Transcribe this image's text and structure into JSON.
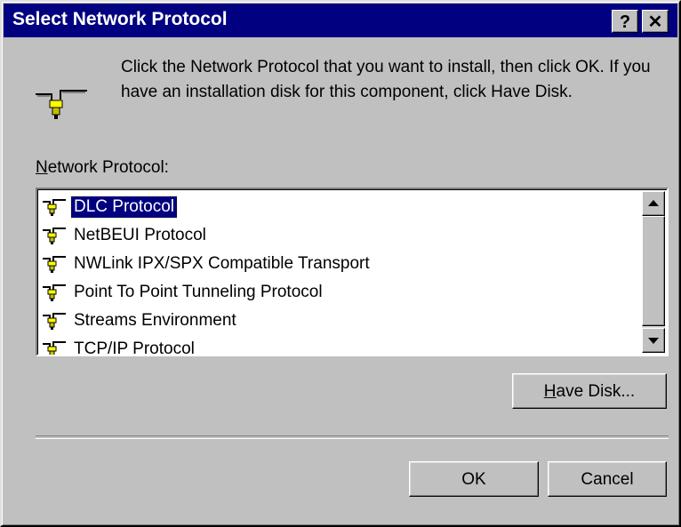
{
  "window": {
    "title": "Select Network Protocol",
    "help_label": "?",
    "close_label": "✕"
  },
  "instructions": "Click the Network Protocol that you want to install, then click OK.  If you have an installation disk for this component, click Have Disk.",
  "list": {
    "label_mnemonic": "N",
    "label_rest": "etwork Protocol:",
    "items": [
      {
        "label": "DLC Protocol",
        "selected": true
      },
      {
        "label": "NetBEUI Protocol",
        "selected": false
      },
      {
        "label": "NWLink IPX/SPX Compatible Transport",
        "selected": false
      },
      {
        "label": "Point To Point Tunneling Protocol",
        "selected": false
      },
      {
        "label": "Streams Environment",
        "selected": false
      },
      {
        "label": "TCP/IP Protocol",
        "selected": false
      }
    ]
  },
  "buttons": {
    "have_disk_mnemonic": "H",
    "have_disk_rest": "ave Disk...",
    "ok": "OK",
    "cancel": "Cancel"
  },
  "icons": {
    "network": "network-protocol-icon"
  },
  "colors": {
    "titlebar": "#000080",
    "face": "#c0c0c0",
    "selection": "#000080"
  }
}
